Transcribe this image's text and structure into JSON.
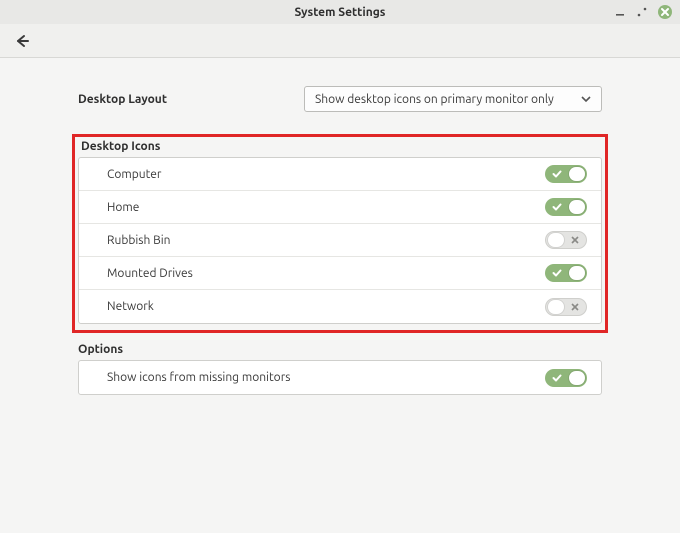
{
  "window": {
    "title": "System Settings"
  },
  "layout": {
    "label": "Desktop Layout",
    "selected": "Show desktop icons on primary monitor only"
  },
  "icons_section": {
    "heading": "Desktop Icons",
    "items": [
      {
        "label": "Computer",
        "on": true
      },
      {
        "label": "Home",
        "on": true
      },
      {
        "label": "Rubbish Bin",
        "on": false
      },
      {
        "label": "Mounted Drives",
        "on": true
      },
      {
        "label": "Network",
        "on": false
      }
    ]
  },
  "options_section": {
    "heading": "Options",
    "items": [
      {
        "label": "Show icons from missing monitors",
        "on": true
      }
    ]
  }
}
